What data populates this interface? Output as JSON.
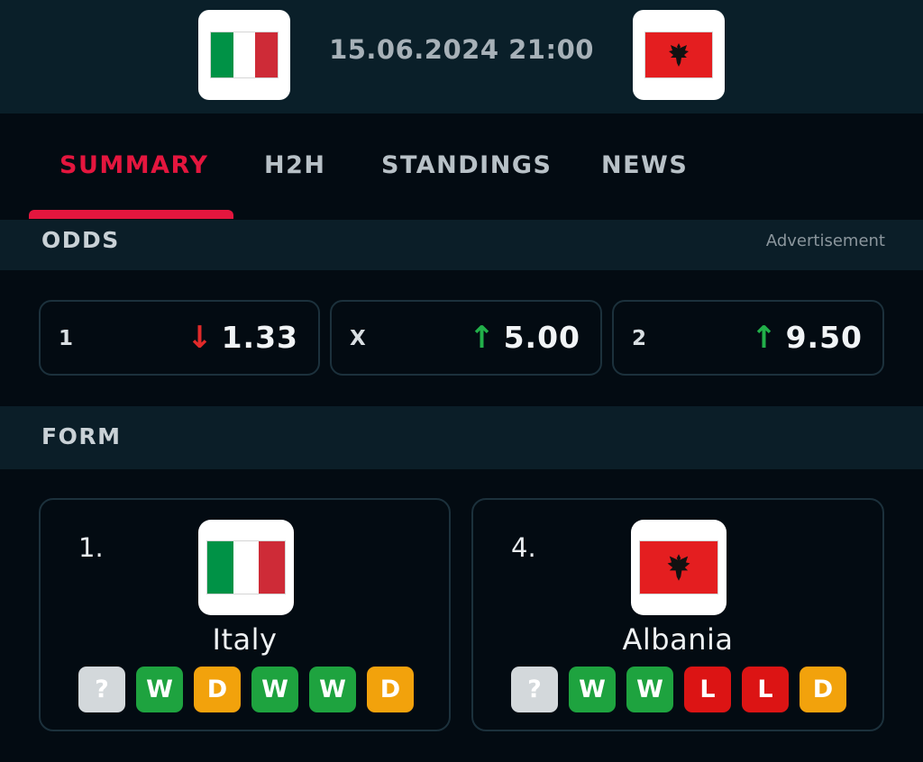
{
  "match": {
    "datetime": "15.06.2024 21:00",
    "home_flag_icon": "italy-flag-icon",
    "away_flag_icon": "albania-flag-icon"
  },
  "tabs": [
    {
      "label": "SUMMARY",
      "active": true
    },
    {
      "label": "H2H",
      "active": false
    },
    {
      "label": "STANDINGS",
      "active": false
    },
    {
      "label": "NEWS",
      "active": false
    }
  ],
  "odds": {
    "title": "ODDS",
    "ad_label": "Advertisement",
    "items": [
      {
        "label": "1",
        "value": "1.33",
        "trend": "down",
        "trend_icon": "arrow-down-icon"
      },
      {
        "label": "X",
        "value": "5.00",
        "trend": "up",
        "trend_icon": "arrow-up-icon"
      },
      {
        "label": "2",
        "value": "9.50",
        "trend": "up",
        "trend_icon": "arrow-up-icon"
      }
    ]
  },
  "form": {
    "title": "FORM",
    "teams": [
      {
        "rank": "1.",
        "name": "Italy",
        "results": [
          "?",
          "W",
          "D",
          "W",
          "W",
          "D"
        ]
      },
      {
        "rank": "4.",
        "name": "Albania",
        "results": [
          "?",
          "W",
          "W",
          "L",
          "L",
          "D"
        ]
      }
    ]
  },
  "colors": {
    "accent": "#e4163e",
    "win": "#1ea33f",
    "draw": "#f2a20c",
    "loss": "#dc1414",
    "unknown": "#d3d8db",
    "odds_up": "#22b04a",
    "odds_down": "#e12a2a"
  }
}
